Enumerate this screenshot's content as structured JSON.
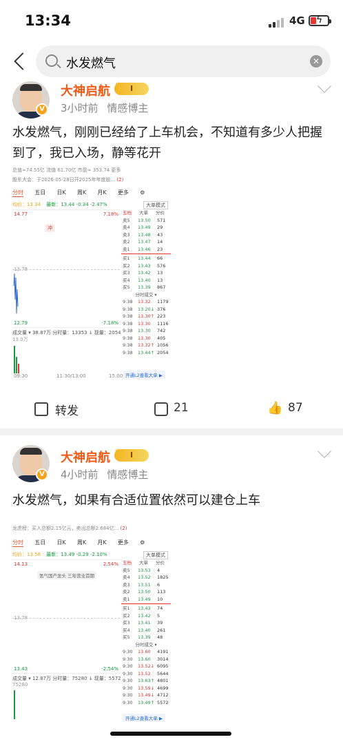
{
  "status": {
    "time": "13:34",
    "network": "4G"
  },
  "search": {
    "query": "水发燃气"
  },
  "posts": [
    {
      "username": "大神启航",
      "level": "I",
      "time": "3小时前",
      "tag": "情感博主",
      "text": "水发燃气，刚刚已经给了上车机会，不知道有多少人把握到了，我已入场，静等花开",
      "shot": {
        "top_line": "总值≈74.55亿   流值  61.70亿   市盈≈  353.74          更多",
        "notice": "股东大会：于2026-05-28日开2025年年度股... ",
        "notice_count": "(2)",
        "tabs": [
          "分时",
          "五日",
          "日K",
          "周K",
          "月K",
          "更多",
          "⚙"
        ],
        "price_line_avg": "均价：13.34",
        "price_line_latest": "最新：13.44  -0.34  -2.47%",
        "mode_button": "大单模式",
        "high": "14.77",
        "low": "12.79",
        "mid": "13.78",
        "pct_high": "7.18%",
        "pct_low": "-7.18%",
        "flag": "冲",
        "ob_tabs": [
          "五档",
          "大单",
          "分价"
        ],
        "sells": [
          [
            "卖5",
            "13.50",
            "571"
          ],
          [
            "卖4",
            "13.49",
            "29"
          ],
          [
            "卖3",
            "13.48",
            "43"
          ],
          [
            "卖2",
            "13.47",
            "14"
          ],
          [
            "卖1",
            "13.46",
            "23"
          ]
        ],
        "buys": [
          [
            "买1",
            "13.44",
            "66"
          ],
          [
            "买2",
            "13.43",
            "576"
          ],
          [
            "买3",
            "13.42",
            "13"
          ],
          [
            "买4",
            "13.40",
            "13"
          ],
          [
            "买5",
            "13.39",
            "867"
          ]
        ],
        "trade_title": "分时成交 ▾",
        "trades": [
          [
            "9:38",
            "13.32",
            "1179"
          ],
          [
            "9:38",
            "13.20↓",
            "376"
          ],
          [
            "9:38",
            "13.30↑",
            "223"
          ],
          [
            "9:38",
            "13.30",
            "1116"
          ],
          [
            "9:38",
            "13.30",
            "742"
          ],
          [
            "9:38",
            "13.30",
            "405"
          ],
          [
            "9:38",
            "13.32↑",
            "1056"
          ],
          [
            "9:38",
            "13.44↑",
            "2054"
          ]
        ],
        "vol_line": "成交量 ▾   38.87万  分时量：13353 ↓ 现量：2054",
        "vol_sub": "13.0万",
        "times": [
          "09:30",
          "11:30/13:00",
          "15:00"
        ],
        "l2": "开通L2查看大单 ▶"
      },
      "actions": {
        "repost": "转发",
        "comments": "21",
        "likes": "87"
      }
    },
    {
      "username": "大神启航",
      "level": "I",
      "time": "4小时前",
      "tag": "情感博主",
      "text": "水发燃气，如果有合适位置依然可以建仓上车",
      "shot": {
        "notice": "龙虎榜：买入总额2.15亿元，卖出总额2.684亿... ",
        "notice_count": "(2)",
        "tabs": [
          "分时",
          "五日",
          "日K",
          "周K",
          "月K",
          "更多",
          "⚙"
        ],
        "price_line_avg": "均价：13.58",
        "price_line_latest": "最新：13.49  -0.29  -2.10%",
        "mode_button": "大单模式",
        "high": "14.13",
        "low": "13.43",
        "mid": "13.78",
        "pct_high": "2.54%",
        "pct_low": "-2.54%",
        "flag": "氢气国产龙头  三年营业首期",
        "ob_tabs": [
          "五档",
          "大单",
          "分价"
        ],
        "sells": [
          [
            "卖5",
            "13.53",
            "4"
          ],
          [
            "卖4",
            "13.52",
            "1825"
          ],
          [
            "卖3",
            "13.51",
            "6"
          ],
          [
            "卖2",
            "13.50",
            "113"
          ],
          [
            "卖1",
            "13.49",
            "10"
          ]
        ],
        "buys": [
          [
            "买1",
            "13.43",
            "74"
          ],
          [
            "买2",
            "13.42",
            "5"
          ],
          [
            "买3",
            "13.41",
            "39"
          ],
          [
            "买4",
            "13.40",
            "261"
          ],
          [
            "买5",
            "13.39",
            "48"
          ]
        ],
        "trade_title": "分时成交 ▾",
        "trades": [
          [
            "9:30",
            "13.60",
            "4191"
          ],
          [
            "9:30",
            "13.60",
            "3014"
          ],
          [
            "9:30",
            "13.52↓",
            "6095"
          ],
          [
            "9:30",
            "13.52",
            "5644"
          ],
          [
            "9:30",
            "13.63↑",
            "4801"
          ],
          [
            "9:30",
            "13.59↓",
            "4699"
          ],
          [
            "9:30",
            "13.49↓",
            "4712"
          ],
          [
            "9:30",
            "13.49↑",
            "5572"
          ]
        ],
        "vol_line": "成交量 ▾   12.87万  分时量：75280 ↓ 现量：5572",
        "vol_sub": "75280",
        "l2": "开通L2查看大单 ▶"
      }
    }
  ]
}
